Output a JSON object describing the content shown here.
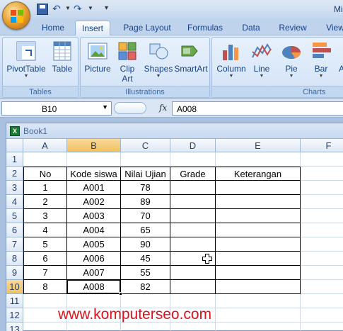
{
  "window": {
    "title_partial": "Mi"
  },
  "tabs": [
    "Home",
    "Insert",
    "Page Layout",
    "Formulas",
    "Data",
    "Review",
    "View"
  ],
  "active_tab": "Insert",
  "ribbon": {
    "groups": [
      {
        "label": "Tables",
        "buttons": [
          {
            "label": "PivotTable",
            "has_dropdown": true
          },
          {
            "label": "Table"
          }
        ]
      },
      {
        "label": "Illustrations",
        "buttons": [
          {
            "label": "Picture"
          },
          {
            "label": "Clip Art",
            "line1": "Clip",
            "line2": "Art"
          },
          {
            "label": "Shapes",
            "has_dropdown": true
          },
          {
            "label": "SmartArt"
          }
        ]
      },
      {
        "label": "Charts",
        "buttons": [
          {
            "label": "Column",
            "has_dropdown": true
          },
          {
            "label": "Line",
            "has_dropdown": true
          },
          {
            "label": "Pie",
            "has_dropdown": true
          },
          {
            "label": "Bar",
            "has_dropdown": true
          },
          {
            "label": "A"
          }
        ]
      }
    ]
  },
  "formula_bar": {
    "name_box": "B10",
    "fx_label": "fx",
    "formula_value": "A008"
  },
  "workbook": {
    "title": "Book1"
  },
  "sheet": {
    "columns": [
      "A",
      "B",
      "C",
      "D",
      "E",
      "F"
    ],
    "rows": [
      "1",
      "2",
      "3",
      "4",
      "5",
      "6",
      "7",
      "8",
      "9",
      "10",
      "11",
      "12",
      "13"
    ],
    "selected_column": "B",
    "selected_row": "10",
    "headers": [
      "No",
      "Kode siswa",
      "Nilai Ujian",
      "Grade",
      "Keterangan"
    ],
    "data": [
      [
        "1",
        "A001",
        "78",
        "",
        ""
      ],
      [
        "2",
        "A002",
        "89",
        "",
        ""
      ],
      [
        "3",
        "A003",
        "70",
        "",
        ""
      ],
      [
        "4",
        "A004",
        "65",
        "",
        ""
      ],
      [
        "5",
        "A005",
        "90",
        "",
        ""
      ],
      [
        "6",
        "A006",
        "45",
        "",
        ""
      ],
      [
        "7",
        "A007",
        "55",
        "",
        ""
      ],
      [
        "8",
        "A008",
        "82",
        "",
        ""
      ]
    ]
  },
  "watermark": "www.komputerseo.com",
  "colors": {
    "selection_header": "#f1c15f",
    "watermark": "#e0101c",
    "ribbon_text": "#15428b"
  }
}
